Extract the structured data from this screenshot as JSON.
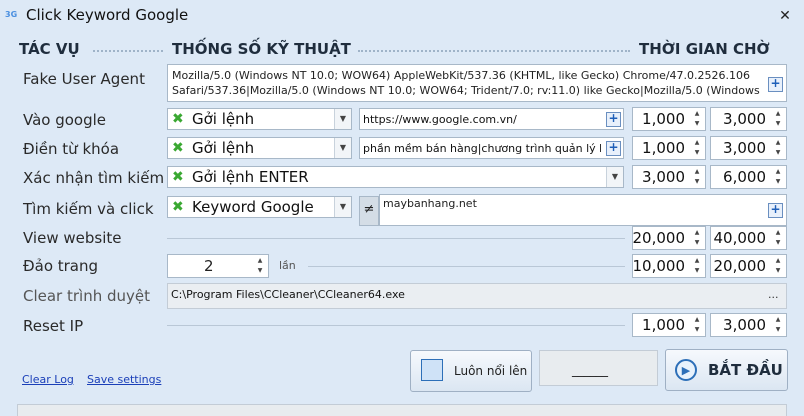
{
  "window": {
    "app_icon_text": "3G",
    "title": "Click Keyword Google",
    "close_glyph": "✕"
  },
  "headers": {
    "task": "TÁC VỤ",
    "spec": "THỐNG SỐ KỸ THUẬT",
    "wait": "THỜI GIAN CHỜ"
  },
  "rows": {
    "fake_user_agent": {
      "label": "Fake User Agent",
      "value_line1": "Mozilla/5.0 (Windows NT 10.0; WOW64) AppleWebKit/537.36 (KHTML, like Gecko) Chrome/47.0.2526.106",
      "value_line2": "Safari/537.36|Mozilla/5.0 (Windows NT 10.0; WOW64; Trident/7.0; rv:11.0) like Gecko|Mozilla/5.0 (Windows NT"
    },
    "vao_google": {
      "label": "Vào google",
      "command": "Gởi lệnh",
      "url": "https://www.google.com.vn/",
      "min": "1,000",
      "max": "3,000"
    },
    "dien_tu_khoa": {
      "label": "Điền từ khóa",
      "command": "Gởi lệnh",
      "keyword": "phần mềm bán hàng|chương trình quản lý bá",
      "min": "1,000",
      "max": "3,000"
    },
    "xac_nhan": {
      "label": "Xác nhận tìm kiếm",
      "command": "Gởi lệnh ENTER",
      "min": "3,000",
      "max": "6,000"
    },
    "tim_kiem_click": {
      "label": "Tìm kiếm và click",
      "command": "Keyword Google",
      "not_equal_symbol": "≠",
      "domain": "maybanhang.net"
    },
    "view_website": {
      "label": "View website",
      "min": "20,000",
      "max": "40,000"
    },
    "dao_trang": {
      "label": "Đảo trang",
      "count": "2",
      "unit": "lần",
      "min": "10,000",
      "max": "20,000"
    },
    "clear_browser": {
      "label": "Clear trình duyệt",
      "path": "C:\\Program Files\\CCleaner\\CCleaner64.exe",
      "browse": "..."
    },
    "reset_ip": {
      "label": "Reset IP",
      "min": "1,000",
      "max": "3,000"
    }
  },
  "footer": {
    "clear_log": "Clear Log",
    "save_settings": "Save settings",
    "always_on_top": "Luôn nổi lên",
    "status_field": "______",
    "start": "BẮT ĐẦU"
  },
  "icons": {
    "command": "green-x-icon",
    "add": "plus-icon",
    "dropdown": "chevron-down-icon",
    "spin": "spin-arrows-icon",
    "play": "play-icon",
    "window": "window-icon"
  }
}
